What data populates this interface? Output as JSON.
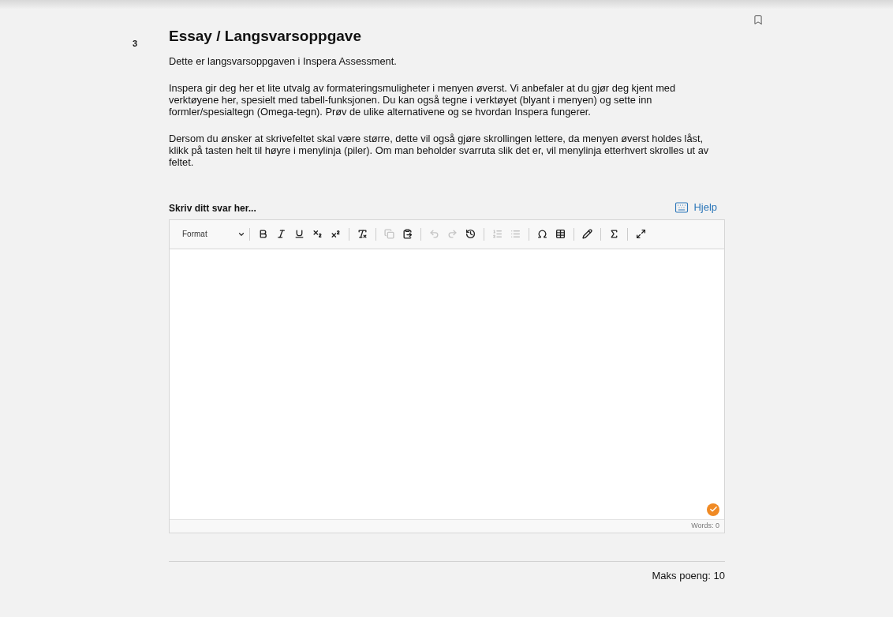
{
  "question": {
    "number": "3",
    "title": "Essay / Langsvarsoppgave",
    "paragraphs": [
      "Dette er langsvarsoppgaven i Inspera Assessment.",
      "Inspera gir deg her et lite utvalg av formateringsmuligheter i menyen øverst. Vi anbefaler at du gjør deg kjent med verktøyene her, spesielt med tabell-funksjonen. Du kan også tegne i verktøyet (blyant i menyen) og sette inn formler/spesialtegn (Omega-tegn).  Prøv de ulike alternativene og se hvordan Inspera fungerer.",
      "Dersom du ønsker at skrivefeltet skal være større, dette vil også gjøre skrollingen lettere, da menyen øverst holdes låst, klikk på tasten helt til høyre i menylinja (piler). Om man beholder svarruta slik det er, vil menylinja etterhvert skrolles ut av feltet."
    ]
  },
  "answer": {
    "label": "Skriv ditt svar her...",
    "help_link": "Hjelp",
    "format_dropdown": "Format",
    "saved": true,
    "word_count": "Words: 0"
  },
  "toolbar_groups": [
    [
      {
        "kind": "bold",
        "disabled": false
      },
      {
        "kind": "italic",
        "disabled": false
      },
      {
        "kind": "underline",
        "disabled": false
      },
      {
        "kind": "subscript",
        "disabled": false
      },
      {
        "kind": "superscript",
        "disabled": false
      }
    ],
    [
      {
        "kind": "remove-format",
        "disabled": false
      }
    ],
    [
      {
        "kind": "copy",
        "disabled": true
      },
      {
        "kind": "paste",
        "disabled": false
      }
    ],
    [
      {
        "kind": "undo",
        "disabled": true
      },
      {
        "kind": "redo",
        "disabled": true
      },
      {
        "kind": "history",
        "disabled": false
      }
    ],
    [
      {
        "kind": "ordered-list",
        "disabled": true
      },
      {
        "kind": "bullet-list",
        "disabled": true
      }
    ],
    [
      {
        "kind": "omega",
        "disabled": false
      },
      {
        "kind": "table",
        "disabled": false
      }
    ],
    [
      {
        "kind": "pencil",
        "disabled": false
      }
    ],
    [
      {
        "kind": "sigma",
        "disabled": false
      }
    ],
    [
      {
        "kind": "fullscreen",
        "disabled": false
      }
    ]
  ],
  "max_points": "Maks poeng: 10"
}
